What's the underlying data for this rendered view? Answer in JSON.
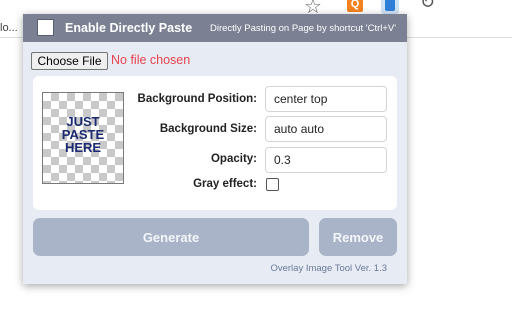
{
  "browser": {
    "left_text": "lo...",
    "star_icon": "star-icon",
    "ext1_label": "Q"
  },
  "header": {
    "title": "Enable Directly Paste",
    "description": "Directly Pasting on Page by shortcut 'Ctrl+V'"
  },
  "file": {
    "button_label": "Choose File",
    "status": "No file chosen"
  },
  "preview": {
    "text": "JUST\nPASTE\nHERE"
  },
  "form": {
    "background_position_label": "Background Position:",
    "background_position_value": "center top",
    "background_size_label": "Background Size:",
    "background_size_value": "auto auto",
    "opacity_label": "Opacity:",
    "opacity_value": "0.3",
    "gray_effect_label": "Gray effect:",
    "gray_effect_checked": false
  },
  "actions": {
    "generate_label": "Generate",
    "remove_label": "Remove"
  },
  "footer": {
    "version_text": "Overlay Image Tool Ver. 1.3"
  },
  "colors": {
    "header_bg": "#7b8193",
    "popup_bg": "#e7ebf3",
    "button_bg": "#a9b4c8",
    "status_red": "#e8444f",
    "preview_text": "#1b2a70"
  }
}
